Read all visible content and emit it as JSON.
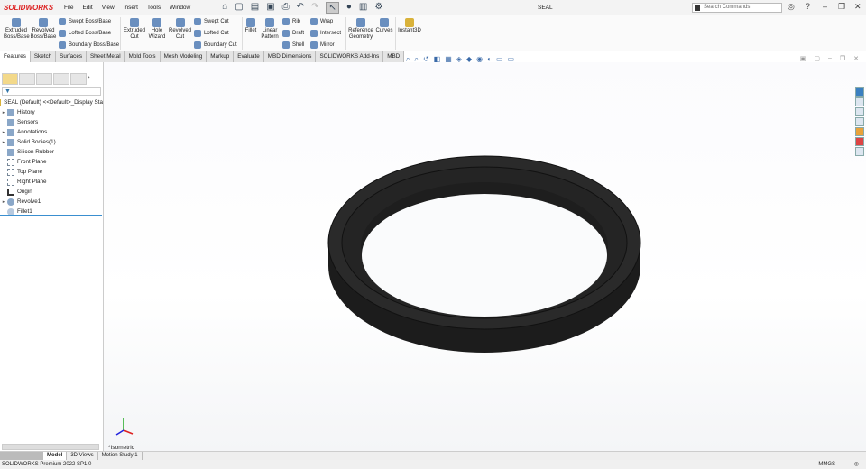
{
  "app": {
    "logo": "SOLIDWORKS",
    "document_title": "SEAL",
    "search_placeholder": "Search Commands"
  },
  "menu": [
    "File",
    "Edit",
    "View",
    "Insert",
    "Tools",
    "Window"
  ],
  "ribbon": {
    "big": [
      "Extruded Boss/Base",
      "Revolved Boss/Base",
      "Extruded Cut",
      "Hole Wizard",
      "Revolved Cut",
      "Fillet",
      "Linear Pattern",
      "Reference Geometry",
      "Curves",
      "Instant3D"
    ],
    "small": [
      "Swept Boss/Base",
      "Lofted Boss/Base",
      "Boundary Boss/Base",
      "Swept Cut",
      "Lofted Cut",
      "Boundary Cut",
      "Rib",
      "Draft",
      "Shell",
      "Wrap",
      "Intersect",
      "Mirror"
    ]
  },
  "tabs": [
    "Features",
    "Sketch",
    "Surfaces",
    "Sheet Metal",
    "Mold Tools",
    "Mesh Modeling",
    "Markup",
    "Evaluate",
    "MBD Dimensions",
    "SOLIDWORKS Add-Ins",
    "MBD"
  ],
  "tree": {
    "root": "SEAL (Default) <<Default>_Display Sta",
    "items": [
      "History",
      "Sensors",
      "Annotations",
      "Solid Bodies(1)",
      "Silicon Rubber",
      "Front Plane",
      "Top Plane",
      "Right Plane",
      "Origin",
      "Revolve1",
      "Fillet1"
    ]
  },
  "viewport": {
    "view_label": "*Isometric"
  },
  "bottom_tabs": [
    "Model",
    "3D Views",
    "Motion Study 1"
  ],
  "status": {
    "product": "SOLIDWORKS Premium 2022 SP1.0",
    "units": "MMGS"
  }
}
